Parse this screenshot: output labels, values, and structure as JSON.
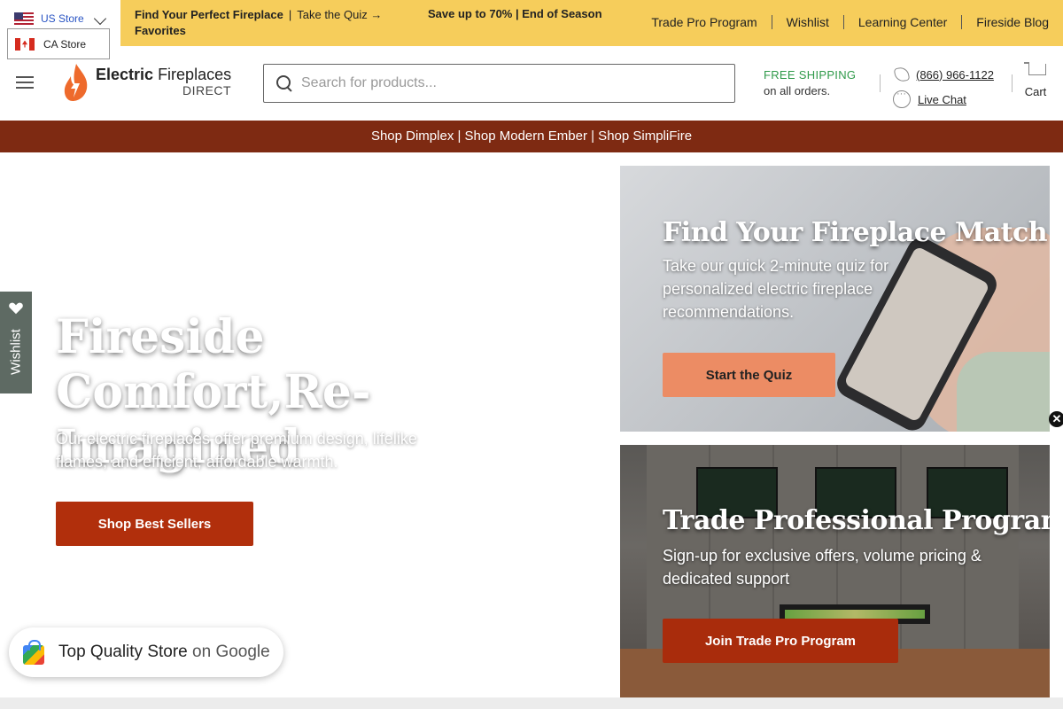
{
  "store_selector": {
    "current": "US Store",
    "alternate": "CA Store"
  },
  "topbar": {
    "promo_quiz_bold": "Find Your Perfect Fireplace",
    "promo_quiz_link": "Take the Quiz →",
    "promo_quiz_tail": "Favorites",
    "promo_sale": "Save up to 70% | End of Season",
    "links": [
      "Trade Pro Program",
      "Wishlist",
      "Learning Center",
      "Fireside Blog"
    ]
  },
  "header": {
    "logo_line1_bold": "Electric",
    "logo_line1": "Fireplaces",
    "logo_line2": "DIRECT",
    "search_placeholder": "Search for products...",
    "shipping_title": "FREE SHIPPING",
    "shipping_sub": "on all orders.",
    "phone": "(866) 966-1122",
    "chat": "Live Chat",
    "cart": "Cart"
  },
  "brandbar": {
    "text": "Shop Dimplex | Shop Modern Ember | Shop SimpliFire"
  },
  "hero": {
    "title": "Fireside Comfort,Re-Imagined",
    "subtitle": "Our electric fireplaces offer premium design, lifelike flames, and efficient, affordable warmth.",
    "button": "Shop Best Sellers"
  },
  "wishlist_tab": {
    "label": "Wishlist"
  },
  "cards": {
    "quiz": {
      "title": "Find Your Fireplace Match",
      "subtitle": "Take our quick 2-minute quiz for personalized electric fireplace recommendations.",
      "button": "Start the Quiz"
    },
    "trade": {
      "title": "Trade Professional Program",
      "subtitle": "Sign-up for exclusive offers, volume pricing & dedicated support",
      "button": "Join Trade Pro Program"
    }
  },
  "google_badge": {
    "main": "Top Quality Store",
    "suffix": "on Google"
  },
  "colors": {
    "topbar": "#f6cd5b",
    "brandbar": "#7e2a12",
    "primary_button": "#b12f0c",
    "quiz_button": "#ec8c64",
    "shipping_green": "#2f9a4a"
  }
}
